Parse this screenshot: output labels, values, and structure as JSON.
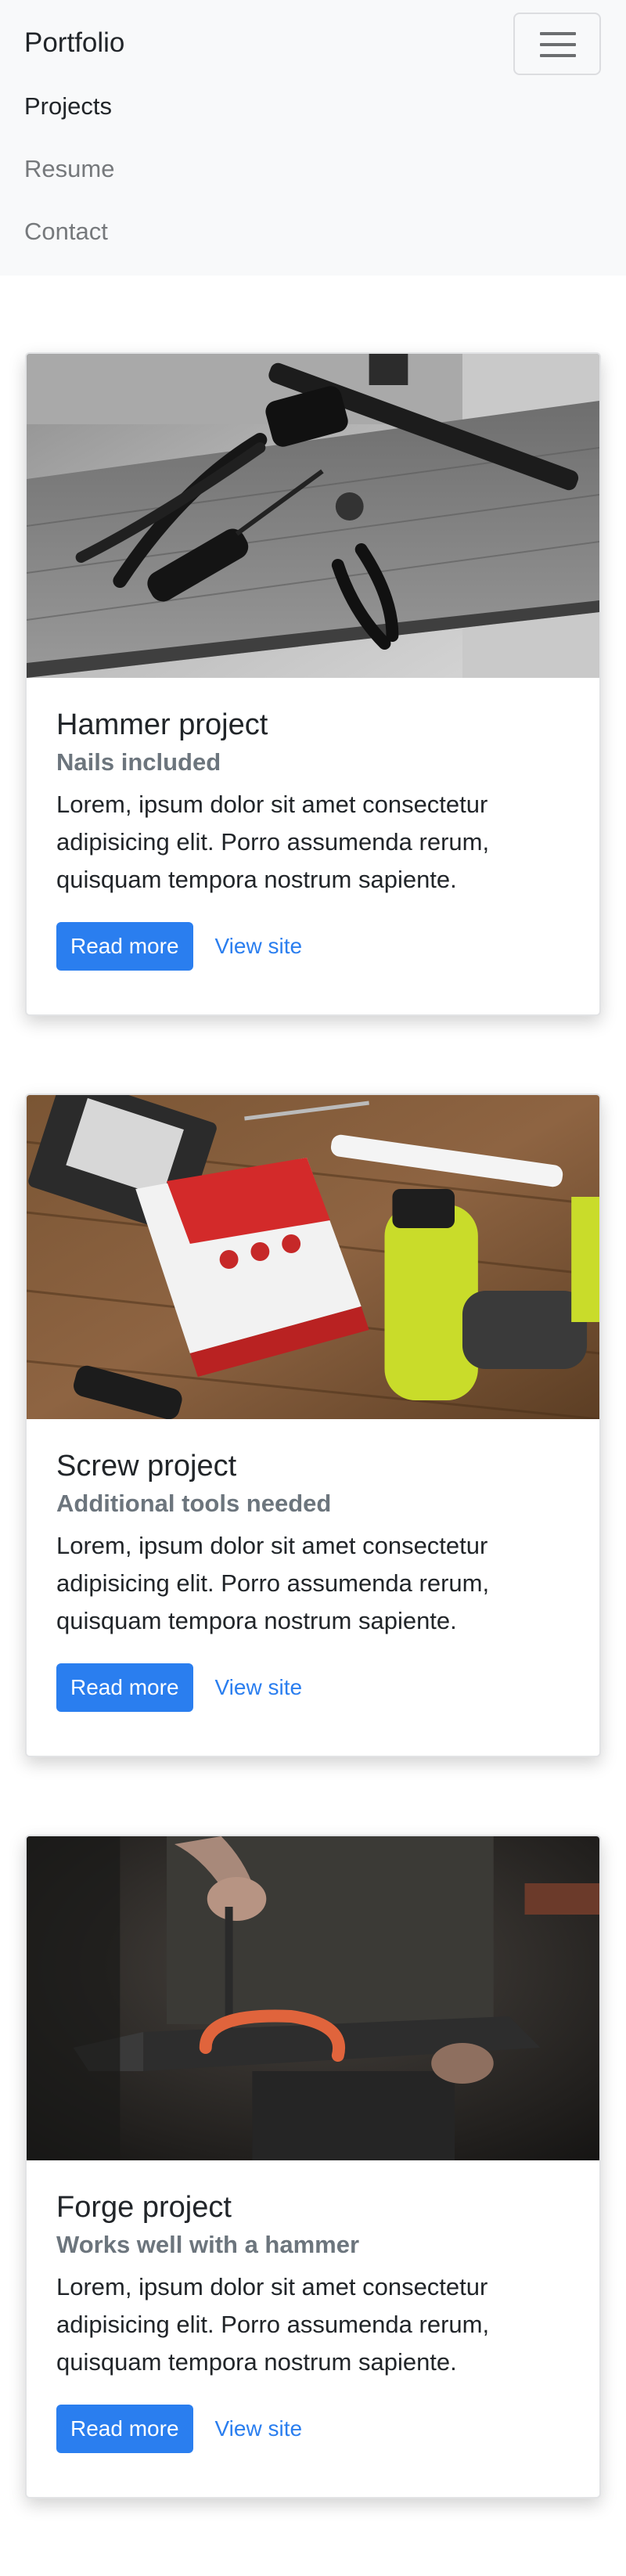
{
  "navbar": {
    "brand": "Portfolio",
    "links": [
      {
        "label": "Projects",
        "active": true
      },
      {
        "label": "Resume",
        "active": false
      },
      {
        "label": "Contact",
        "active": false
      }
    ],
    "toggler_icon": "hamburger-icon"
  },
  "projects": [
    {
      "title": "Hammer project",
      "subtitle": "Nails included",
      "text": "Lorem, ipsum dolor sit amet consectetur adipisicing elit. Porro assumenda rerum, quisquam tempora nostrum sapiente.",
      "read_more": "Read more",
      "view_site": "View site",
      "image": "workbench-tools-photo"
    },
    {
      "title": "Screw project",
      "subtitle": "Additional tools needed",
      "text": "Lorem, ipsum dolor sit amet consectetur adipisicing elit. Porro assumenda rerum, quisquam tempora nostrum sapiente.",
      "read_more": "Read more",
      "view_site": "View site",
      "image": "drill-and-screws-photo"
    },
    {
      "title": "Forge project",
      "subtitle": "Works well with a hammer",
      "text": "Lorem, ipsum dolor sit amet consectetur adipisicing elit. Porro assumenda rerum, quisquam tempora nostrum sapiente.",
      "read_more": "Read more",
      "view_site": "View site",
      "image": "anvil-horseshoe-photo"
    }
  ],
  "colors": {
    "primary": "#2a7eef",
    "navbar_bg": "#f8f9fa",
    "muted_text": "#6c757d"
  }
}
